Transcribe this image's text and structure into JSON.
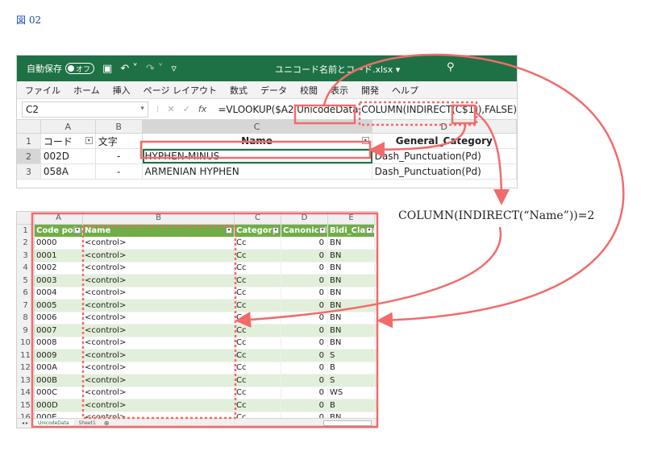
{
  "figure_label": "図 02",
  "top_window": {
    "titlebar": {
      "autosave_label": "自動保存",
      "autosave_state": "オフ",
      "filename": "ユニコード名前とコード.xlsx ▾",
      "search_icon": "search-icon"
    },
    "menu": [
      "ファイル",
      "ホーム",
      "挿入",
      "ページ レイアウト",
      "数式",
      "データ",
      "校閲",
      "表示",
      "開発",
      "ヘルプ"
    ],
    "name_box": "C2",
    "formula": "=VLOOKUP($A2,UnicodeData,COLUMN(INDIRECT(C$1)),FALSE)",
    "formula_parts": [
      "=VLOOKUP($A2,",
      "UnicodeData",
      ",",
      "COLUMN(INDIRECT(",
      "C$1",
      ")),FALSE)"
    ],
    "columns": [
      "A",
      "B",
      "C",
      "D"
    ],
    "header_row": {
      "num": "1",
      "a": "コード",
      "b": "文字",
      "c": "Name",
      "d": "General_Category"
    },
    "rows": [
      {
        "num": "2",
        "a": "002D",
        "b": "-",
        "c": "HYPHEN-MINUS",
        "d": "Dash_Punctuation(Pd)"
      },
      {
        "num": "3",
        "a": "058A",
        "b": "֊",
        "c": "ARMENIAN HYPHEN",
        "d": "Dash_Punctuation(Pd)"
      }
    ]
  },
  "bottom_window": {
    "columns": [
      "A",
      "B",
      "C",
      "D",
      "E"
    ],
    "headers": {
      "num": "1",
      "a": "Code point",
      "b": "Name",
      "c": "Category",
      "d": "Canonical",
      "e": "Bidi_Class"
    },
    "rows": [
      {
        "num": "2",
        "a": "0000",
        "b": "<control>",
        "c": "Cc",
        "d": "0",
        "e": "BN"
      },
      {
        "num": "3",
        "a": "0001",
        "b": "<control>",
        "c": "Cc",
        "d": "0",
        "e": "BN"
      },
      {
        "num": "4",
        "a": "0002",
        "b": "<control>",
        "c": "Cc",
        "d": "0",
        "e": "BN"
      },
      {
        "num": "5",
        "a": "0003",
        "b": "<control>",
        "c": "Cc",
        "d": "0",
        "e": "BN"
      },
      {
        "num": "6",
        "a": "0004",
        "b": "<control>",
        "c": "Cc",
        "d": "0",
        "e": "BN"
      },
      {
        "num": "7",
        "a": "0005",
        "b": "<control>",
        "c": "Cc",
        "d": "0",
        "e": "BN"
      },
      {
        "num": "8",
        "a": "0006",
        "b": "<control>",
        "c": "Cc",
        "d": "0",
        "e": "BN"
      },
      {
        "num": "9",
        "a": "0007",
        "b": "<control>",
        "c": "Cc",
        "d": "0",
        "e": "BN"
      },
      {
        "num": "10",
        "a": "0008",
        "b": "<control>",
        "c": "Cc",
        "d": "0",
        "e": "BN"
      },
      {
        "num": "11",
        "a": "0009",
        "b": "<control>",
        "c": "Cc",
        "d": "0",
        "e": "S"
      },
      {
        "num": "12",
        "a": "000A",
        "b": "<control>",
        "c": "Cc",
        "d": "0",
        "e": "B"
      },
      {
        "num": "13",
        "a": "000B",
        "b": "<control>",
        "c": "Cc",
        "d": "0",
        "e": "S"
      },
      {
        "num": "14",
        "a": "000C",
        "b": "<control>",
        "c": "Cc",
        "d": "0",
        "e": "WS"
      },
      {
        "num": "15",
        "a": "000D",
        "b": "<control>",
        "c": "Cc",
        "d": "0",
        "e": "B"
      },
      {
        "num": "16",
        "a": "000E",
        "b": "<control>",
        "c": "Cc",
        "d": "0",
        "e": "BN"
      }
    ],
    "sheet_tabs": [
      "UnicodeData",
      "Sheet1"
    ],
    "add_sheet": "⊕"
  },
  "annotation": "COLUMN(INDIRECT(“Name”))=2",
  "colors": {
    "excel_green": "#1e7145",
    "table_header_green": "#70ad47",
    "table_band": "#e2efda",
    "highlight_red": "#f26b6b",
    "figure_label": "#1a4fb0"
  }
}
